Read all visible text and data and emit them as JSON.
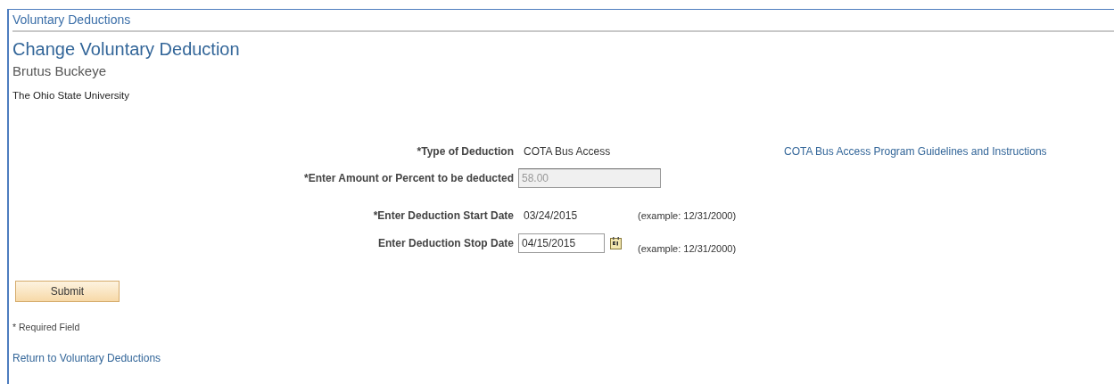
{
  "section_title": "Voluntary Deductions",
  "page_title": "Change Voluntary Deduction",
  "employee_name": "Brutus Buckeye",
  "organization": "The Ohio State University",
  "fields": [
    {
      "kind": "text",
      "label": "*Type of Deduction",
      "value": "COTA Bus Access",
      "link": "COTA Bus Access Program Guidelines and Instructions"
    },
    {
      "kind": "input",
      "label": "*Enter Amount or Percent to be deducted",
      "value": "58.00",
      "disabled": true
    },
    {
      "kind": "text",
      "label": "*Enter Deduction Start Date",
      "value": "03/24/2015",
      "example": "(example: 12/31/2000)"
    },
    {
      "kind": "date",
      "label": "Enter Deduction Stop Date",
      "value": "04/15/2015",
      "disabled": false,
      "example": "(example: 12/31/2000)"
    }
  ],
  "submit_button": "Submit",
  "required_note": "* Required Field",
  "return_link": "Return to Voluntary Deductions"
}
